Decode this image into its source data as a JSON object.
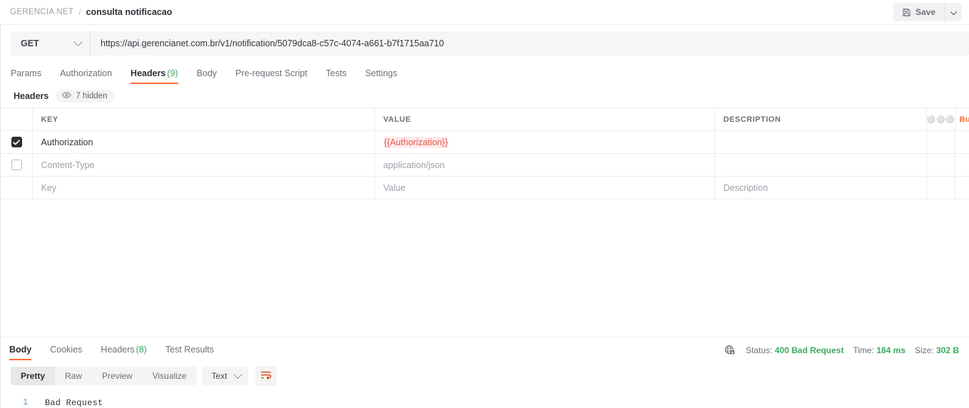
{
  "topbar": {
    "collection": "GERENCIA NET",
    "separator": "/",
    "request_name": "consulta notificacao",
    "save_label": "Save",
    "save_icon": "floppy-disk-icon",
    "save_caret_icon": "chevron-down-icon"
  },
  "request": {
    "method": "GET",
    "method_caret_icon": "chevron-down-icon",
    "url": "https://api.gerencianet.com.br/v1/notification/5079dca8-c57c-4074-a661-b7f1715aa710",
    "tabs": [
      {
        "label": "Params",
        "count": "",
        "active": false
      },
      {
        "label": "Authorization",
        "count": "",
        "active": false
      },
      {
        "label": "Headers",
        "count": "(9)",
        "active": true
      },
      {
        "label": "Body",
        "count": "",
        "active": false
      },
      {
        "label": "Pre-request Script",
        "count": "",
        "active": false
      },
      {
        "label": "Tests",
        "count": "",
        "active": false
      },
      {
        "label": "Settings",
        "count": "",
        "active": false
      }
    ]
  },
  "headers_section": {
    "title": "Headers",
    "hidden_pill": {
      "icon": "eye-icon",
      "label": "7 hidden"
    },
    "columns": [
      "KEY",
      "VALUE",
      "DESCRIPTION"
    ],
    "options_icon": "ellipsis-icon",
    "bulk_edit_label": "Bu",
    "rows": [
      {
        "checked": true,
        "key": "Authorization",
        "key_style": "text",
        "value": "{{Authorization}}",
        "value_style": "variable",
        "description": "",
        "description_style": "text"
      },
      {
        "checked": false,
        "key": "Content-Type",
        "key_style": "placeholder",
        "value": "application/json",
        "value_style": "placeholder",
        "description": "",
        "description_style": "text"
      },
      {
        "checked": null,
        "key": "Key",
        "key_style": "placeholder",
        "value": "Value",
        "value_style": "placeholder",
        "description": "Description",
        "description_style": "placeholder"
      }
    ]
  },
  "response": {
    "tabs": [
      {
        "label": "Body",
        "count": "",
        "active": true
      },
      {
        "label": "Cookies",
        "count": "",
        "active": false
      },
      {
        "label": "Headers",
        "count": "(8)",
        "active": false
      },
      {
        "label": "Test Results",
        "count": "",
        "active": false
      }
    ],
    "meta": {
      "network_icon": "globe-lock-icon",
      "status_label": "Status:",
      "status_value": "400 Bad Request",
      "time_label": "Time:",
      "time_value": "184 ms",
      "size_label": "Size:",
      "size_value": "302 B",
      "value_color": "#3caa5c"
    },
    "view_modes": [
      {
        "label": "Pretty",
        "active": true
      },
      {
        "label": "Raw",
        "active": false
      },
      {
        "label": "Preview",
        "active": false
      },
      {
        "label": "Visualize",
        "active": false
      }
    ],
    "format": {
      "label": "Text",
      "caret_icon": "chevron-down-icon"
    },
    "wrap_button_icon": "wrap-text-icon",
    "body": {
      "line_number": "1",
      "line_text": "Bad Request"
    }
  },
  "colors": {
    "accent": "#ff6c37",
    "success": "#3caa5c",
    "variable_error": "#e8584b",
    "text": "#32353c",
    "muted": "#6b7078"
  }
}
